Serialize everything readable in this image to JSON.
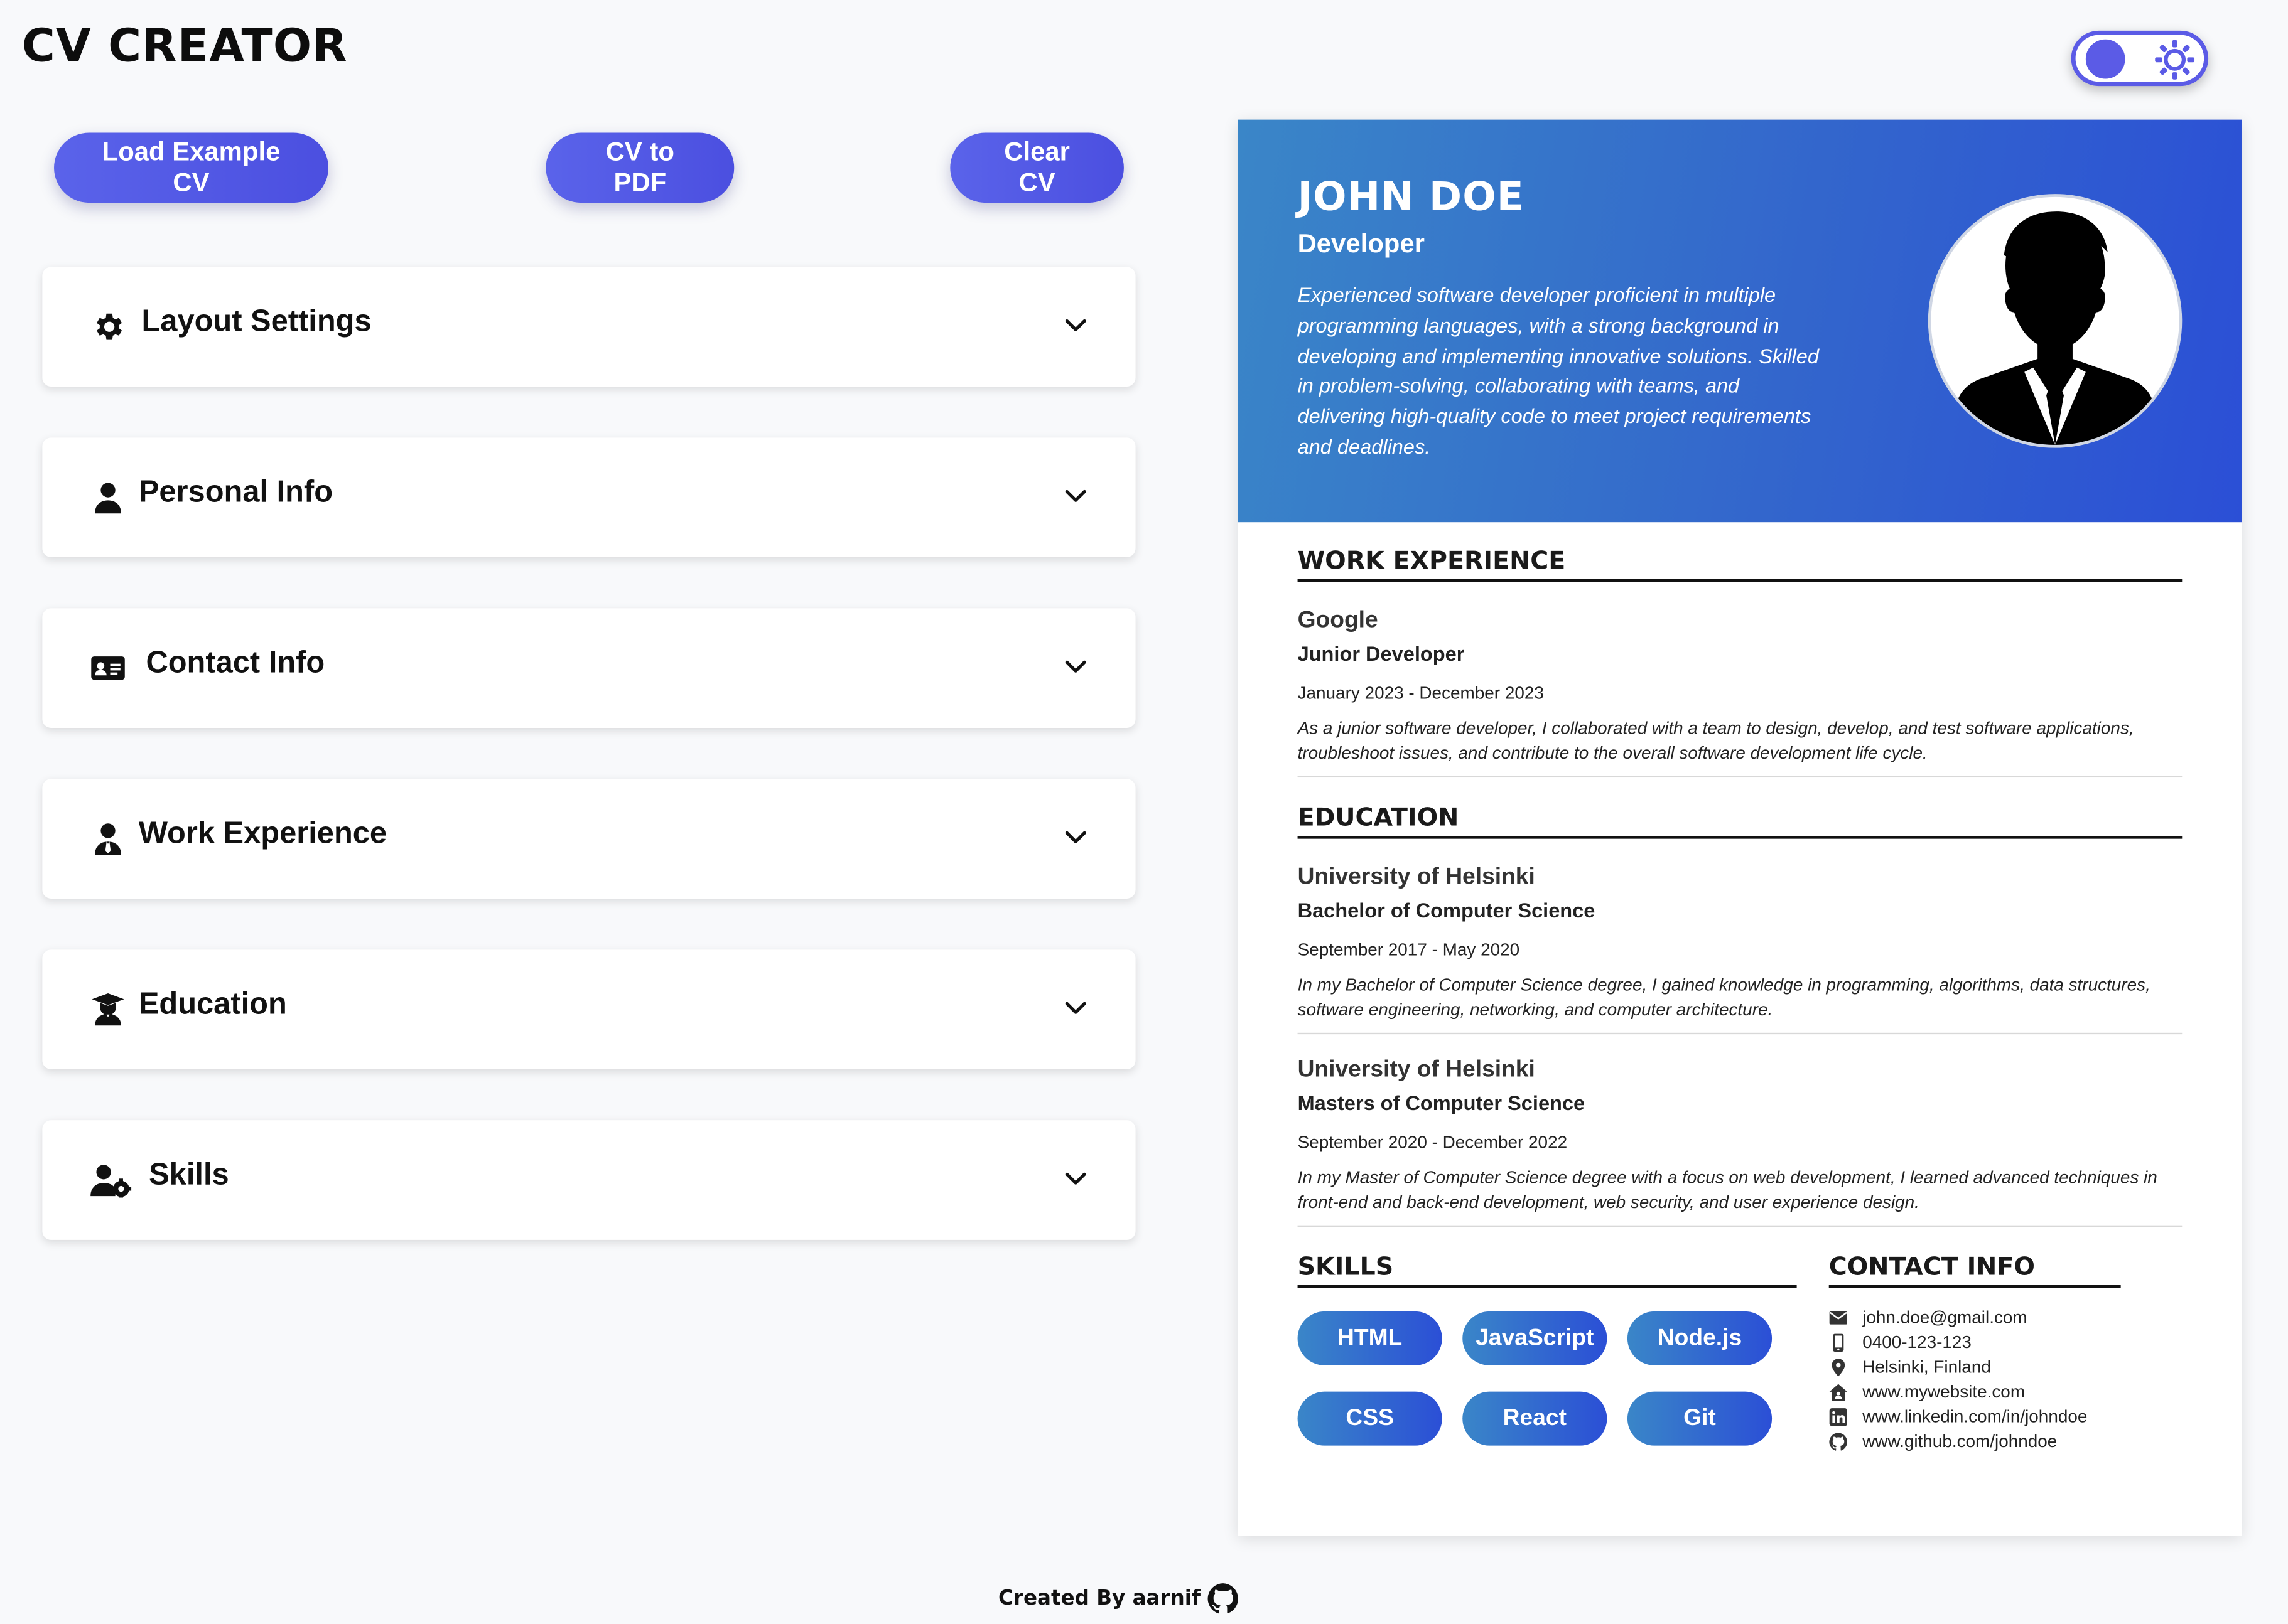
{
  "app": {
    "title": "CV CREATOR"
  },
  "toolbar": {
    "load_example": "Load Example CV",
    "to_pdf": "CV to PDF",
    "clear": "Clear CV"
  },
  "theme_toggle": {
    "icon": "sun-icon",
    "accent": "#5b5be6"
  },
  "panels": [
    {
      "label": "Layout Settings",
      "icon": "gear-icon"
    },
    {
      "label": "Personal Info",
      "icon": "user-icon"
    },
    {
      "label": "Contact Info",
      "icon": "id-card-icon"
    },
    {
      "label": "Work Experience",
      "icon": "user-tie-icon"
    },
    {
      "label": "Education",
      "icon": "graduate-icon"
    },
    {
      "label": "Skills",
      "icon": "user-gear-icon"
    }
  ],
  "footer": {
    "text": "Created By aarnif",
    "icon": "github-icon"
  },
  "cv": {
    "name": "JOHN DOE",
    "title": "Developer",
    "summary": "Experienced software developer proficient in multiple programming languages, with a strong background in developing and implementing innovative solutions. Skilled in problem-solving, collaborating with teams, and delivering high-quality code to meet project requirements and deadlines.",
    "headings": {
      "work": "WORK EXPERIENCE",
      "education": "EDUCATION",
      "skills": "SKILLS",
      "contact": "CONTACT INFO"
    },
    "work": [
      {
        "org": "Google",
        "role": "Junior Developer",
        "dates": "January 2023 - December 2023",
        "desc": "As a junior software developer, I collaborated with a team to design, develop, and test software applications, troubleshoot issues, and contribute to the overall software development life cycle."
      }
    ],
    "education": [
      {
        "org": "University of Helsinki",
        "role": "Bachelor of Computer Science",
        "dates": "September 2017 - May 2020",
        "desc": "In my Bachelor of Computer Science degree, I gained knowledge in programming, algorithms, data structures, software engineering, networking, and computer architecture."
      },
      {
        "org": "University of Helsinki",
        "role": "Masters of Computer Science",
        "dates": "September 2020 - December 2022",
        "desc": "In my Master of Computer Science degree with a focus on web development, I learned advanced techniques in front-end and back-end development, web security, and user experience design."
      }
    ],
    "skills": [
      "HTML",
      "JavaScript",
      "Node.js",
      "CSS",
      "React",
      "Git"
    ],
    "contact": [
      {
        "icon": "envelope-icon",
        "text": "john.doe@gmail.com"
      },
      {
        "icon": "phone-icon",
        "text": "0400-123-123"
      },
      {
        "icon": "location-pin-icon",
        "text": "Helsinki, Finland"
      },
      {
        "icon": "home-icon",
        "text": "www.mywebsite.com"
      },
      {
        "icon": "linkedin-icon",
        "text": "www.linkedin.com/in/johndoe"
      },
      {
        "icon": "github-icon",
        "text": "www.github.com/johndoe"
      }
    ],
    "colors": {
      "header_start": "#3a86c8",
      "header_end": "#2b4fd6",
      "button": "#5a63ea"
    }
  }
}
